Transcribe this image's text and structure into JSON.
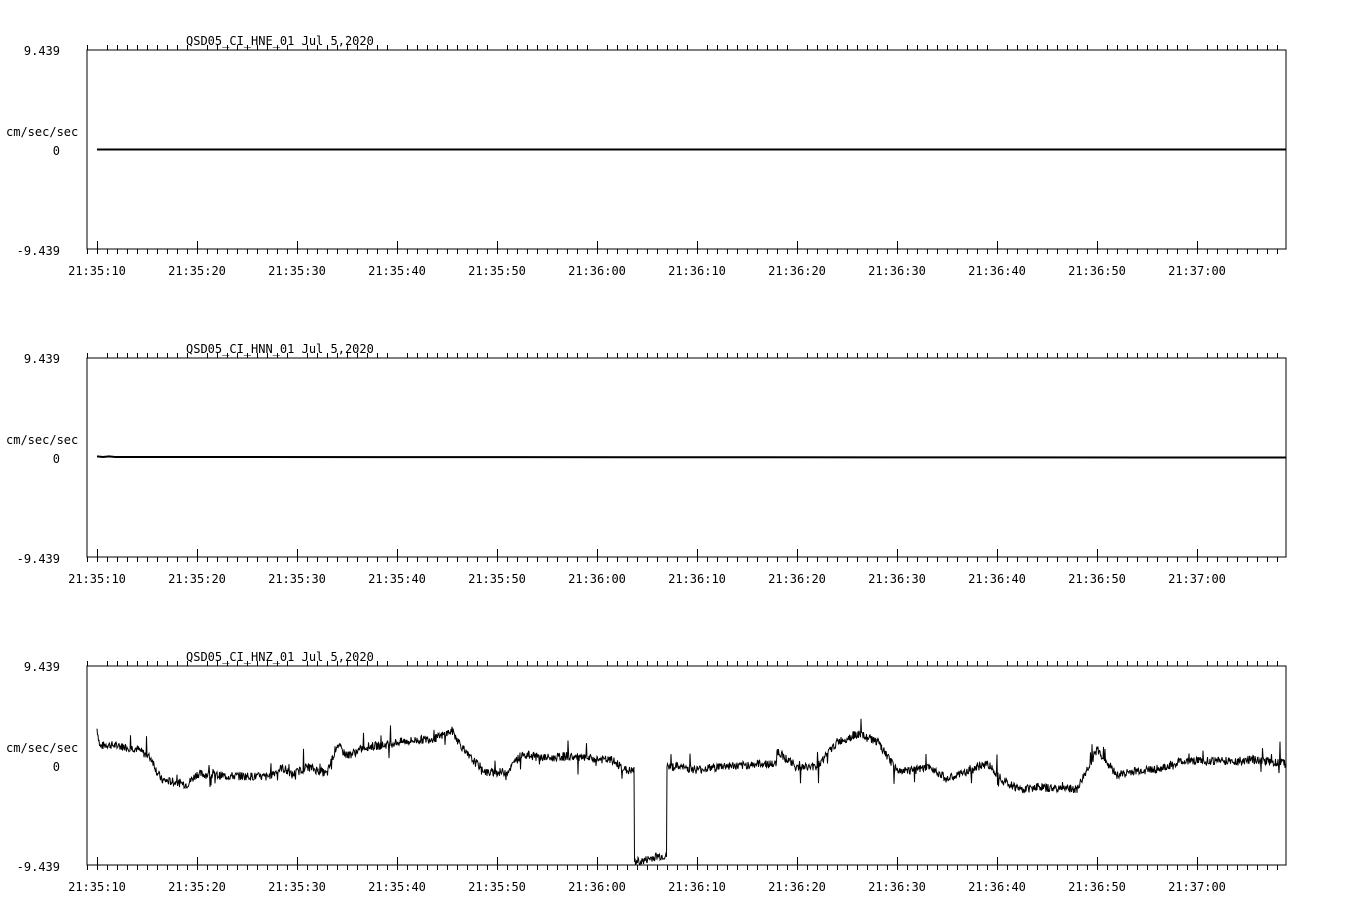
{
  "chart_data": [
    {
      "type": "line",
      "title": "QSD05_CI_HNE_01  Jul 5,2020",
      "ylabel": "cm/sec/sec",
      "ylim": [
        -9.439,
        9.439
      ],
      "ytick_labels": [
        "9.439",
        "0",
        "-9.439"
      ],
      "xlim": [
        "21:35:09",
        "21:37:09"
      ],
      "xtick_labels": [
        "21:35:10",
        "21:35:20",
        "21:35:30",
        "21:35:40",
        "21:35:50",
        "21:36:00",
        "21:36:10",
        "21:36:20",
        "21:36:30",
        "21:36:40",
        "21:36:50",
        "21:37:00"
      ],
      "series": [
        {
          "color": "#000000",
          "data_start_s": 1.0,
          "x": [
            1,
            120
          ],
          "y": [
            0,
            0
          ]
        }
      ]
    },
    {
      "type": "line",
      "title": "QSD05_CI_HNN_01  Jul 5,2020",
      "ylabel": "cm/sec/sec",
      "ylim": [
        -9.439,
        9.439
      ],
      "ytick_labels": [
        "9.439",
        "0",
        "-9.439"
      ],
      "xlim": [
        "21:35:09",
        "21:37:09"
      ],
      "xtick_labels": [
        "21:35:10",
        "21:35:20",
        "21:35:30",
        "21:35:40",
        "21:35:50",
        "21:36:00",
        "21:36:10",
        "21:36:20",
        "21:36:30",
        "21:36:40",
        "21:36:50",
        "21:37:00"
      ],
      "series": [
        {
          "color": "#000000",
          "x": [
            1,
            1.6,
            2.2,
            2.8,
            120
          ],
          "y": [
            0.1,
            0.05,
            0.1,
            0.05,
            0
          ]
        }
      ]
    },
    {
      "type": "line",
      "title": "QSD05_CI_HNZ_01  Jul 5,2020",
      "ylabel": "cm/sec/sec",
      "ylim": [
        -9.439,
        9.439
      ],
      "ytick_labels": [
        "9.439",
        "0",
        "-9.439"
      ],
      "xlim": [
        "21:35:09",
        "21:37:09"
      ],
      "xtick_labels": [
        "21:35:10",
        "21:35:20",
        "21:35:30",
        "21:35:40",
        "21:35:50",
        "21:36:00",
        "21:36:10",
        "21:36:20",
        "21:36:30",
        "21:36:40",
        "21:36:50",
        "21:37:00"
      ],
      "series": [
        {
          "color": "#000000",
          "x": [
            1.0,
            1.3,
            2.0,
            3.5,
            5.0,
            6.5,
            7.0,
            7.5,
            9.0,
            10.0,
            11.0,
            12.5,
            14.0,
            16.0,
            18.0,
            19.5,
            20.5,
            22.0,
            24.0,
            25.0,
            26.0,
            28.0,
            29.5,
            31.0,
            33.0,
            35.0,
            36.5,
            38.0,
            40.0,
            42.0,
            43.5,
            45.0,
            46.5,
            48.0,
            49.5,
            51.0,
            52.5,
            54.0,
            55.5,
            57.0,
            59.0,
            61.0,
            62.5,
            64.0,
            65.5,
            65.6,
            67.5,
            68.5,
            68.9,
            69.0,
            71.0,
            73.0,
            75.0,
            77.0,
            79.0,
            81.0,
            83.0,
            84.5,
            86.0,
            88.0,
            90.0,
            92.0,
            93.5,
            95.0,
            96.5,
            97.5,
            99.0,
            101.0,
            103.0,
            104.5,
            106.0,
            107.5,
            109.0,
            110.5,
            111.9,
            112.0,
            113.0,
            115.0,
            117.0,
            118.5,
            120.0
          ],
          "y": [
            3.5,
            1.8,
            2.0,
            1.8,
            1.6,
            0.6,
            -0.6,
            -1.4,
            -1.6,
            -1.8,
            -0.8,
            -0.9,
            -1.0,
            -1.0,
            -1.1,
            -0.2,
            -0.9,
            -0.1,
            -0.8,
            2.0,
            0.9,
            1.8,
            1.9,
            2.2,
            2.4,
            2.6,
            3.3,
            1.0,
            -0.7,
            -0.6,
            1.1,
            0.8,
            0.7,
            0.9,
            0.7,
            0.6,
            0.5,
            -0.5,
            -9.1,
            -8.6,
            -0.1,
            -0.4,
            -0.2,
            0.0,
            -0.1,
            0.0,
            0.2,
            0.1,
            0.1,
            1.4,
            -0.2,
            -0.1,
            2.2,
            3.0,
            2.3,
            -0.5,
            -0.4,
            -0.2,
            -1.3,
            -0.6,
            0.2,
            -1.7,
            -2.3,
            -2.0,
            -2.2,
            -2.1,
            -2.3,
            1.5,
            -0.9,
            -0.6,
            -0.4,
            -0.3,
            0.3,
            0.5,
            0.4,
            0.4,
            0.5,
            0.4,
            0.6,
            0.3,
            0.2
          ]
        }
      ]
    }
  ]
}
